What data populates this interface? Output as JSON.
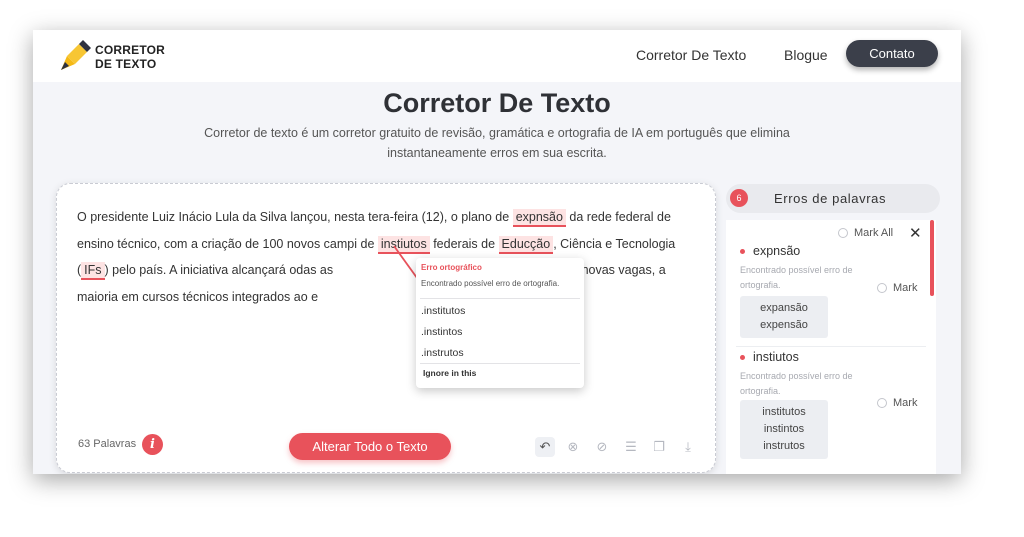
{
  "header": {
    "logo_line1": "CORRETOR",
    "logo_line2": "DE TEXTO",
    "nav": [
      "Corretor De Texto",
      "Blogue"
    ],
    "contact_button": "Contato"
  },
  "hero": {
    "title": "Corretor De Texto",
    "subtitle_line1": "Corretor de texto é um corretor gratuito de revisão, gramática e ortografia de IA em português que elimina",
    "subtitle_line2": "instantaneamente erros em sua escrita."
  },
  "editor": {
    "t1": "O presidente Luiz Inácio Lula da Silva lançou, nesta tera-feira (12), o plano de ",
    "e1": "expnsão",
    "t2": " da rede federal de ensino técnico, com a criação de 100 novos campi de ",
    "e2": "instiutos",
    "t3": " federais de ",
    "e3": "Educção",
    "t4": ", Ciência e Tecnologia (",
    "e4": "IFs",
    "t5": ") pelo país.   A iniciativa alcançará odas as",
    "t5b": "gerar 140 mil novas vagas, a maioria em cursos técnicos integrados ao e",
    "word_count": "63 Palavras",
    "info_icon": "i",
    "change_all_button": "Alterar Todo o Texto",
    "tools": [
      "undo-icon",
      "clear-icon",
      "check-icon",
      "list-icon",
      "copy-icon",
      "download-icon"
    ]
  },
  "popup": {
    "title": "Erro ortográfico",
    "description": "Encontrado possível erro de ortografia.",
    "suggestions": [
      ".institutos",
      ".instintos",
      ".instrutos"
    ],
    "ignore": "Ignore in this"
  },
  "panel": {
    "count": "6",
    "title": "Erros de palavras",
    "mark_all": "Mark All",
    "close": "✕",
    "errors": [
      {
        "word": "expnsão",
        "desc": "Encontrado possível erro de ortografia.",
        "mark": "Mark",
        "suggestions": [
          "expansão",
          "expensão"
        ]
      },
      {
        "word": "instiutos",
        "desc": "Encontrado possível erro de ortografia.",
        "mark": "Mark",
        "suggestions": [
          "institutos",
          "instintos",
          "instrutos"
        ]
      }
    ]
  },
  "colors": {
    "accent": "#e8525b",
    "dark_button": "#3b3f4a",
    "background": "#f4f5f9"
  }
}
